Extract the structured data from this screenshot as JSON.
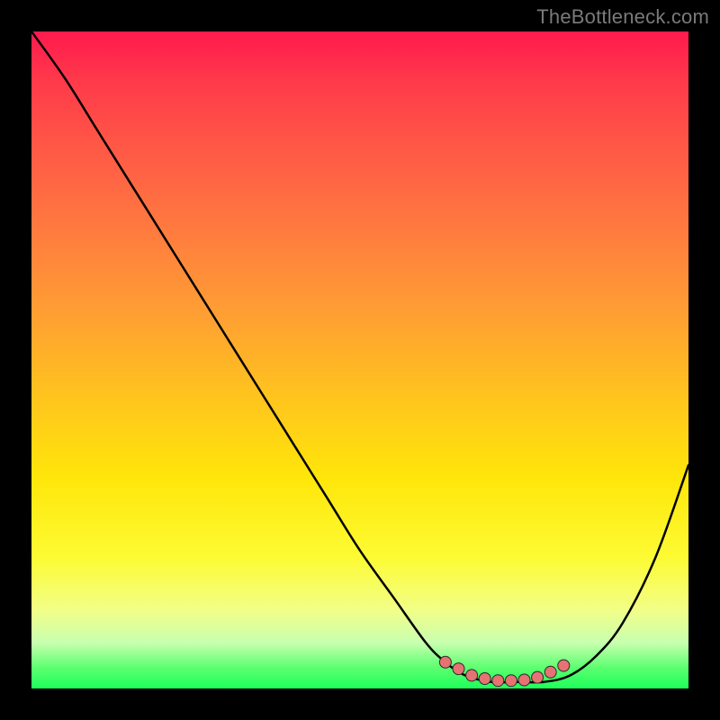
{
  "watermark": "TheBottleneck.com",
  "colors": {
    "frame": "#000000",
    "curve": "#000000",
    "dots_fill": "#e57373",
    "dots_stroke": "#2b2b2b"
  },
  "chart_data": {
    "type": "line",
    "title": "",
    "xlabel": "",
    "ylabel": "",
    "xlim": [
      0,
      100
    ],
    "ylim": [
      0,
      100
    ],
    "grid": false,
    "legend": false,
    "series": [
      {
        "name": "bottleneck-curve",
        "x": [
          0,
          5,
          10,
          15,
          20,
          25,
          30,
          35,
          40,
          45,
          50,
          55,
          60,
          63,
          66,
          70,
          74,
          78,
          82,
          86,
          90,
          95,
          100
        ],
        "y": [
          100,
          93,
          85,
          77,
          69,
          61,
          53,
          45,
          37,
          29,
          21,
          14,
          7,
          4,
          2,
          1,
          1,
          1,
          2,
          5,
          10,
          20,
          34
        ]
      }
    ],
    "highlight_points": {
      "name": "optimal-range-dots",
      "x": [
        63,
        65,
        67,
        69,
        71,
        73,
        75,
        77,
        79,
        81
      ],
      "y": [
        4,
        3,
        2,
        1.5,
        1.2,
        1.2,
        1.3,
        1.7,
        2.5,
        3.5
      ]
    }
  }
}
